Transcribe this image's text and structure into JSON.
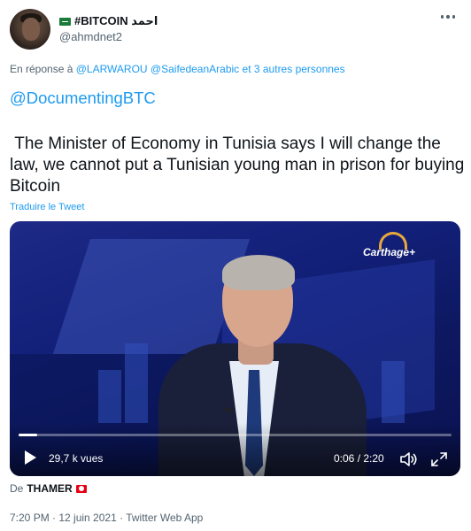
{
  "author": {
    "display_name": "#BITCOIN احمد",
    "handle": "@ahmdnet2"
  },
  "reply": {
    "prefix": "En réponse à",
    "to": "@LARWAROU @SaifedeanArabic",
    "and": "et",
    "others": "3 autres personnes"
  },
  "tweet": {
    "mention": "@DocumentingBTC",
    "text": " The Minister of Economy in Tunisia says I will change the law, we cannot put a Tunisian young man in prison for buying Bitcoin",
    "translate": "Traduire le Tweet"
  },
  "video": {
    "channel_logo": "Carthage+",
    "views": "29,7 k vues",
    "time": "0:06 / 2:20",
    "progress": 0.043
  },
  "attribution": {
    "prefix": "De",
    "author": "THAMER"
  },
  "meta": {
    "timestamp": "7:20 PM · 12 juin 2021 · Twitter Web App"
  },
  "colors": {
    "link": "#1d9bf0",
    "secondary_text": "#536471",
    "primary_text": "#0f1419"
  },
  "icons": {
    "more": "more-horizontal-icon",
    "play": "play-icon",
    "volume": "volume-icon",
    "expand": "fullscreen-icon"
  }
}
